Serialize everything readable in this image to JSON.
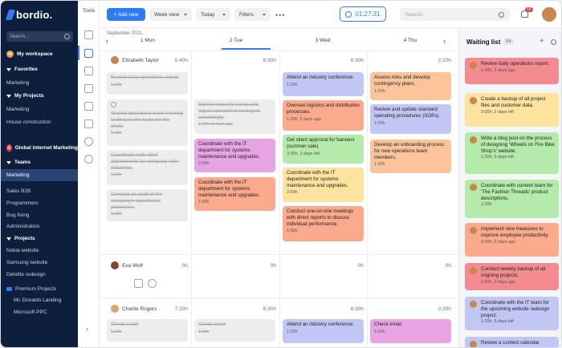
{
  "brand": {
    "name": "bordio."
  },
  "sidebar": {
    "search_placeholder": "Search...",
    "workspace": {
      "label": "My workspace",
      "badge": "W"
    },
    "favorites": "Favorites",
    "fav_items": [
      "Marketing"
    ],
    "my_projects": "My Projects",
    "my_project_items": [
      "Marketing",
      "House construction"
    ],
    "team_space": {
      "label": "Global Internet Marketing",
      "badge": "G"
    },
    "teams": "Teams",
    "team_items": [
      "Marketing",
      "Sales B2B",
      "Programmers",
      "Bug fixing",
      "Administration"
    ],
    "projects": "Projects",
    "project_items": [
      "Nokia website",
      "Samsung website",
      "Deloitte redesign"
    ],
    "premium": "Premium Projects",
    "premium_items": [
      "Mc Donalds Landing",
      "Microsoft PPC"
    ]
  },
  "rail": {
    "title": "Tools"
  },
  "toolbar": {
    "add_new": "+ Add new",
    "view": "Week view",
    "today": "Today",
    "filters": "Filters",
    "more": "•••",
    "timer": "01:27:31",
    "search_placeholder": "Search...",
    "notifications": "15"
  },
  "calendar": {
    "month": "September 2021",
    "days": [
      "1 Mon",
      "2 Tue",
      "3 Wed",
      "4 Thu"
    ],
    "users": [
      {
        "name": "Elizabeth Taylor",
        "totals": [
          "5:40h",
          "6:30h",
          "6:30h",
          "2:20h"
        ]
      },
      {
        "name": "Eva Wolf",
        "totals": [
          "0h",
          "0h",
          "0h",
          "0h"
        ]
      },
      {
        "name": "Charlie Rogers",
        "totals": [
          "7:20h",
          "6:30h",
          "6:30h",
          "2:20h"
        ]
      }
    ],
    "tasks": {
      "t1": {
        "title": "Review daily operations report.",
        "meta": "1:20h"
      },
      "t2": {
        "title": "Weekly operations team meeting to discuss the tasks for the week.",
        "meta": "1:20h"
      },
      "t3": {
        "title": "Coordinate with other departments for company-wide initiatives.",
        "meta": "1:20h"
      },
      "t4": {
        "title": "Conduct an audit of the company's operational processes.",
        "meta": "1:20h"
      },
      "t5": {
        "title": "Monitor industry trends and adjust operational strategies accordingly.",
        "meta": "1:20h, 2 days ago"
      },
      "t6": {
        "title": "Coordinate with the IT department for systems maintenance and upgrades.",
        "meta": "2:00h"
      },
      "t7": {
        "title": "Coordinate with the IT department for systems maintenance and upgrades.",
        "meta": "1:00h"
      },
      "t8": {
        "title": "Attend an industry conference.",
        "meta": "1:20h"
      },
      "t9": {
        "title": "Oversee logistics and distribution processes.",
        "meta": "1:20h, 2 days ago"
      },
      "t10": {
        "title": "Get client approval for banners (summer sale)",
        "meta": "3:30h, 2 days left"
      },
      "t11": {
        "title": "Coordinate with the IT department for systems maintenance and upgrades.",
        "meta": "2:00h"
      },
      "t12": {
        "title": "Conduct one-on-one meetings with direct reports to discuss individual performance.",
        "meta": "1:00h"
      },
      "t13": {
        "title": "Assess risks and develop contingency plans.",
        "meta": "1:20h"
      },
      "t14": {
        "title": "Review and update standard operating procedures (SOPs).",
        "meta": "1:20h"
      },
      "t15": {
        "title": "Develop an onboarding process for new operations team members.",
        "meta": "1:20h"
      },
      "t16": {
        "title": "Check email",
        "meta": "1:20h"
      },
      "t17": {
        "title": "Check email",
        "meta": "1:20h"
      },
      "t18": {
        "title": "Attend an industry conference.",
        "meta": "1:20h"
      },
      "t19": {
        "title": "Check email",
        "meta": "1:20h"
      }
    }
  },
  "waiting_list": {
    "title": "Waiting list",
    "count": "34",
    "cards": [
      {
        "title": "Review daily operations report.",
        "meta": "1:40h, 2 days ago"
      },
      {
        "title": "Create a backup of all project files and customer data.",
        "meta": "3:00h, 2 days left"
      },
      {
        "title": "Write a blog post on the process of designing 'Wheels on Fire Bike Shop's' website.",
        "meta": "1:20h, 5 days left"
      },
      {
        "title": "Coordinate with content team for 'The Fashion Threads' product descriptions.",
        "meta": "1:20h"
      },
      {
        "title": "Implement new measures to improve employee productivity.",
        "meta": "2:00h, 2 days ago"
      },
      {
        "title": "Conduct weekly backup of all ongoing projects.",
        "meta": "1:20h, 2 days ago"
      },
      {
        "title": "Coordinate with the IT team for the upcoming website redesign project.",
        "meta": "1:20h, 5 days left"
      },
      {
        "title": "Review a content calendar",
        "meta": ""
      }
    ]
  }
}
